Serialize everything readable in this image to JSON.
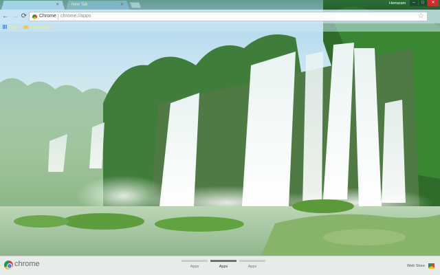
{
  "tabs": [
    {
      "label": "",
      "active": true
    },
    {
      "label": "New Tab",
      "active": false
    }
  ],
  "window": {
    "profile": "Hemaram",
    "minimize": "–",
    "maximize": "□",
    "close": "✕"
  },
  "toolbar": {
    "back": "←",
    "forward": "→",
    "reload": "⟳",
    "omnibox_label": "Chrome",
    "url": "chrome://apps",
    "star": "☆"
  },
  "bookmarks": [
    {
      "label": "Apps",
      "icon": "apps-grid-icon"
    },
    {
      "label": "Bookmarks",
      "icon": "folder-icon"
    }
  ],
  "launcher": {
    "brand": "chrome",
    "pages": [
      {
        "label": "Apps",
        "active": false
      },
      {
        "label": "Apps",
        "active": true
      },
      {
        "label": "Apps",
        "active": false
      }
    ],
    "webstore": "Web Store"
  },
  "colors": {
    "close_button": "#c9302c",
    "bookmark_text": "#e6f08a"
  }
}
